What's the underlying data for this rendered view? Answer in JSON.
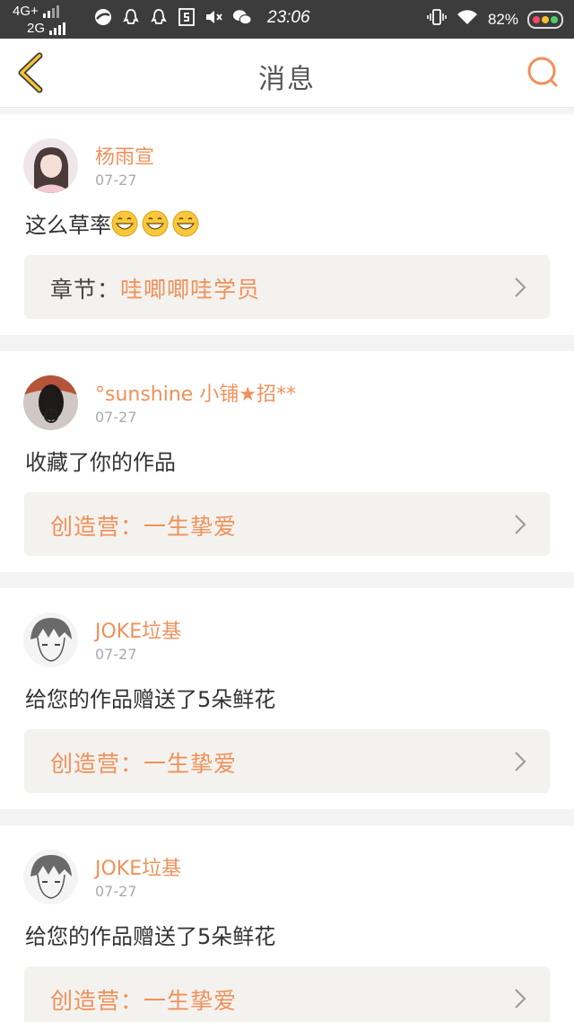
{
  "status_bar": {
    "network_top": "4G+",
    "network_bottom": "2G",
    "time": "23:06",
    "battery_percent": "82%"
  },
  "nav": {
    "title": "消息",
    "back_icon": "back-chevron-icon",
    "search_icon": "search-icon"
  },
  "colors": {
    "accent": "#f0905a",
    "status_bar": "#3c3c3c",
    "ref_bg": "#f3f2ee"
  },
  "messages": [
    {
      "username": "杨雨宣",
      "date": "07-27",
      "content": "这么草率",
      "emoji_count": 3,
      "ref_label": "章节：",
      "ref_value": "哇唧唧哇学员"
    },
    {
      "username": "°sunshine 小铺★招**",
      "date": "07-27",
      "content": "收藏了你的作品",
      "ref_label": "创造营：",
      "ref_value": "一生挚爱"
    },
    {
      "username": "JOKE垃基",
      "date": "07-27",
      "content": "给您的作品赠送了5朵鲜花",
      "ref_label": "创造营：",
      "ref_value": "一生挚爱"
    },
    {
      "username": "JOKE垃基",
      "date": "07-27",
      "content": "给您的作品赠送了5朵鲜花",
      "ref_label": "创造营：",
      "ref_value": "一生挚爱"
    }
  ]
}
